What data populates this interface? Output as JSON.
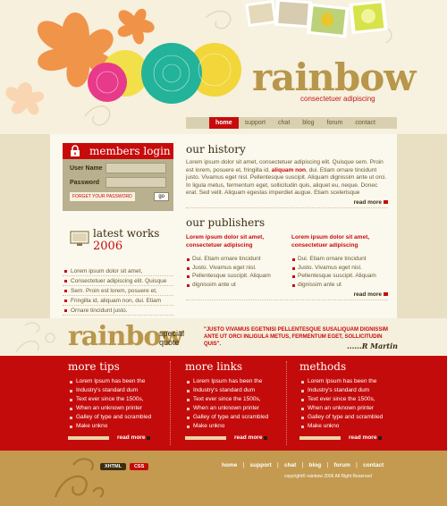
{
  "brand": {
    "name": "rainbow",
    "tagline": "consectetuer adipiscing"
  },
  "nav": {
    "items": [
      "home",
      "support",
      "chat",
      "blog",
      "forum",
      "contact"
    ],
    "active": "home"
  },
  "login": {
    "title": "members login",
    "username_label": "User Name",
    "password_label": "Password",
    "forgot_label": "FORGET YOUR PASSWORD",
    "go_label": "go"
  },
  "latest_works": {
    "title": "latest works",
    "year": "2006",
    "items": [
      "Lorem ipsum dolor sit amet,",
      "Consectetuer adipiscing elit. Quisque",
      "Sem. Proin est lorem, posuere et,",
      "Fringilla id, aliquam non, dui. Etiam",
      "Ornare tincidunt justo."
    ]
  },
  "history": {
    "title": "our history",
    "text_before": "Lorem ipsum dolor sit amet, consectetuer adipiscing elit. Quisque sem. Proin est lorem, posuere et, fringilla id,",
    "highlight": "aliquam non",
    "text_after": ", dui. Etiam ornare tincidunt justo. Vivamus eget nisl. Pellentesque suscipit. Aliquam dignissim ante ut orci. In ligula metus, fermentum eget, sollicitudin quis, aliquet eu, neque. Donec erat. Sed velit. Aliquam egestas imperdiet augue. Etiam scelerisque",
    "read_more": "read more"
  },
  "publishers": {
    "title": "our publishers",
    "columns": [
      {
        "subtitle": "Lorem ipsum dolor sit amet, consectetuer adipiscing",
        "items": [
          "Dui. Etiam ornare tincidunt",
          "Justo. Vivamus eget nisl.",
          "Pellentesque suscipit. Aliquam",
          "dignissim ante ut"
        ]
      },
      {
        "subtitle": "Lorem ipsum dolor sit amet, consectetuer adipiscing",
        "items": [
          "Dui. Etiam ornare tincidunt",
          "Justo. Vivamus eget nisl.",
          "Pellentesque suscipit. Aliquam",
          "dignissim ante ut"
        ]
      }
    ],
    "read_more": "read more"
  },
  "quote": {
    "brand": "rainbow",
    "label_line1": "special",
    "label_line2": "quote",
    "text": "\"JUSTO VIVAMUS EGETNISI PELLENTESQUE SUSALIQUAM DIGNISSIM ANTE UT ORCI INLIGULA METUS, FERMENTUM EGET, SOLLICITUDIN QUIS\".",
    "author": "......R Martin"
  },
  "bottom": {
    "columns": [
      {
        "title": "more tips",
        "items": [
          "Lorem Ipsum has been the",
          "Industry's standard dum",
          "Text ever since the 1500s,",
          "When an unknown printer",
          "Galley of type and scrambled",
          "Make unkno"
        ],
        "read_more": "read more"
      },
      {
        "title": "more links",
        "items": [
          "Lorem Ipsum has been the",
          "Industry's standard dum",
          "Text ever since the 1500s,",
          "When an unknown printer",
          "Galley of type and scrambled",
          "Make unkno"
        ],
        "read_more": "read more"
      },
      {
        "title": "methods",
        "items": [
          "Lorem Ipsum has been the",
          "Industry's standard dum",
          "Text ever since the 1500s,",
          "When an unknown printer",
          "Galley of type and scrambled",
          "Make unkno"
        ],
        "read_more": "read more"
      }
    ]
  },
  "footer": {
    "badge_xhtml": "XHTML",
    "badge_css": "CSS",
    "nav": [
      "home",
      "support",
      "chat",
      "blog",
      "forum",
      "contact"
    ],
    "copyright": "copyright© rainbow 2006 All Right Reserved"
  },
  "colors": {
    "accent_red": "#c40b0b",
    "gold": "#b8964b",
    "cream": "#f5efdd",
    "footer_tan": "#c49a50"
  }
}
